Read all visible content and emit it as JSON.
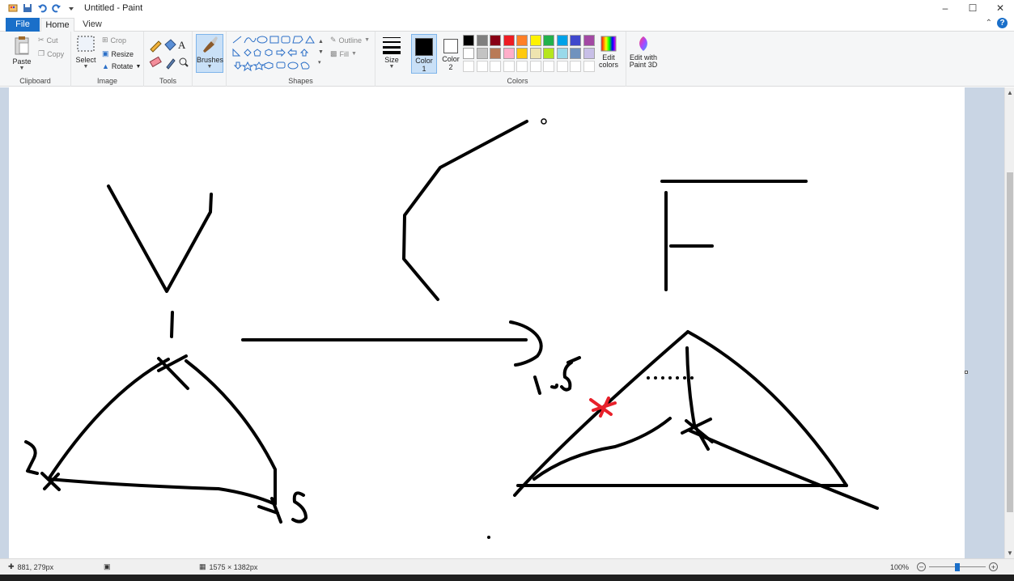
{
  "window": {
    "title": "Untitled - Paint"
  },
  "tabs": {
    "file": "File",
    "home": "Home",
    "view": "View"
  },
  "clipboard": {
    "paste": "Paste",
    "cut": "Cut",
    "copy": "Copy",
    "label": "Clipboard"
  },
  "image": {
    "select": "Select",
    "crop": "Crop",
    "resize": "Resize",
    "rotate": "Rotate",
    "label": "Image"
  },
  "tools": {
    "label": "Tools",
    "text_glyph": "A"
  },
  "brushes": {
    "label": "Brushes"
  },
  "shapes": {
    "outline": "Outline",
    "fill": "Fill",
    "label": "Shapes"
  },
  "size": {
    "label": "Size"
  },
  "colors": {
    "color1_label": "Color",
    "color1_num": "1",
    "color2_label": "Color",
    "color2_num": "2",
    "edit_colors": "Edit colors",
    "label": "Colors",
    "color1": "#000000",
    "color2": "#ffffff",
    "palette_row1": [
      "#000000",
      "#7f7f7f",
      "#880015",
      "#ed1c24",
      "#ff7f27",
      "#fff200",
      "#22b14c",
      "#00a2e8",
      "#3f48cc",
      "#a349a4"
    ],
    "palette_row2": [
      "#ffffff",
      "#c3c3c3",
      "#b97a57",
      "#ffaec9",
      "#ffc90e",
      "#efe4b0",
      "#b5e61d",
      "#99d9ea",
      "#7092be",
      "#c8bfe7"
    ]
  },
  "paint3d": {
    "label": "Edit with Paint 3D"
  },
  "status": {
    "cursor": "881, 279px",
    "image_size": "1575 × 1382px",
    "zoom": "100%"
  },
  "canvas": {
    "stroke_color": "#000000",
    "accent_mark_color": "#e8202a"
  }
}
